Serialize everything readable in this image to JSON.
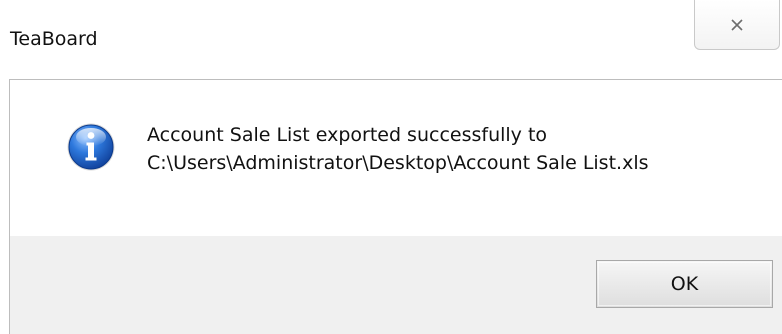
{
  "window": {
    "title": "TeaBoard"
  },
  "dialog": {
    "icon": "info-icon",
    "message_line1": "Account Sale List exported successfully to",
    "message_line2": "C:\\Users\\Administrator\\Desktop\\Account Sale List.xls",
    "ok_label": "OK"
  },
  "colors": {
    "footer_bg": "#f0f0f0",
    "info_blue": "#1f5fbf"
  }
}
